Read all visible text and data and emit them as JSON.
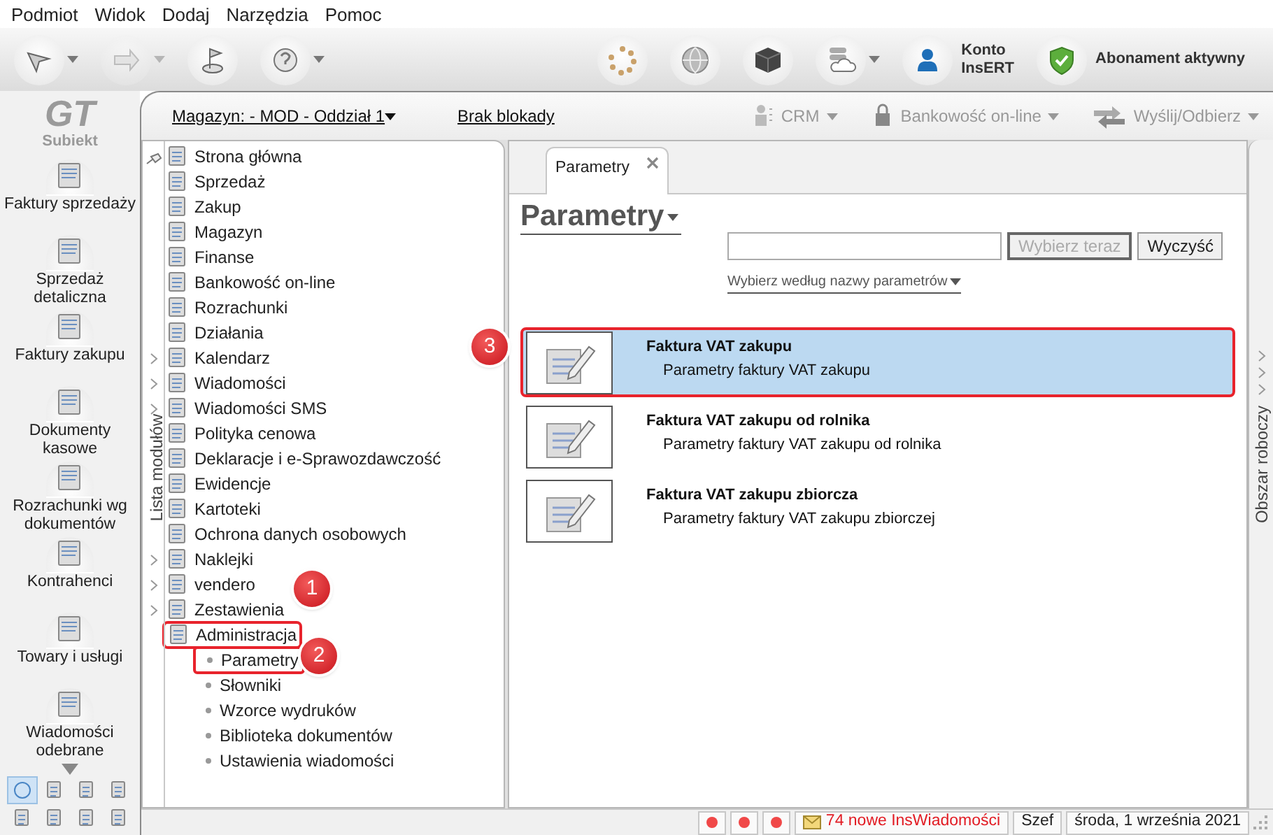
{
  "menu": [
    {
      "label": "Podmiot"
    },
    {
      "label": "Widok"
    },
    {
      "label": "Dodaj"
    },
    {
      "label": "Narzędzia"
    },
    {
      "label": "Pomoc"
    }
  ],
  "toolbar": {
    "left": [
      {
        "kind": "arrow",
        "dropdown": true,
        "disabled": false
      },
      {
        "kind": "forward",
        "dropdown": true,
        "disabled": true
      },
      {
        "kind": "flag",
        "dropdown": false,
        "disabled": false
      },
      {
        "kind": "help",
        "dropdown": true,
        "disabled": false
      }
    ],
    "right": [
      {
        "kind": "spinner",
        "dropdown": false
      },
      {
        "kind": "globe",
        "dropdown": false
      },
      {
        "kind": "cube",
        "dropdown": false
      },
      {
        "kind": "cloud",
        "dropdown": true
      }
    ],
    "account": {
      "line1": "Konto",
      "line2": "InsERT"
    },
    "subscription": "Abonament aktywny"
  },
  "app_logo": {
    "mark": "GT",
    "name": "Subiekt"
  },
  "sidebar": [
    {
      "label": "Faktury sprzedaży"
    },
    {
      "label": "Sprzedaż detaliczna"
    },
    {
      "label": "Faktury zakupu"
    },
    {
      "label": "Dokumenty kasowe"
    },
    {
      "label": "Rozrachunki wg dokumentów"
    },
    {
      "label": "Kontrahenci"
    },
    {
      "label": "Towary i usługi"
    },
    {
      "label": "Wiadomości odebrane"
    }
  ],
  "sidebar_shortcuts": [
    {
      "selected": true
    },
    {
      "selected": false
    },
    {
      "selected": false
    },
    {
      "selected": false
    },
    {
      "selected": false
    },
    {
      "selected": false
    },
    {
      "selected": false
    },
    {
      "selected": false
    }
  ],
  "context_bar": {
    "warehouse": "Magazyn: - MOD - Oddział 1",
    "lock": "Brak blokady",
    "actions": [
      {
        "kind": "crm",
        "label": "CRM",
        "disabled": true
      },
      {
        "kind": "bank",
        "label": "Bankowość on-line",
        "disabled": true
      },
      {
        "kind": "send",
        "label": "Wyślij/Odbierz",
        "disabled": true
      }
    ]
  },
  "modules": {
    "title": "Lista modułów",
    "items": [
      {
        "label": "Strona główna",
        "expandable": false,
        "highlighted": false
      },
      {
        "label": "Sprzedaż",
        "expandable": false,
        "highlighted": false
      },
      {
        "label": "Zakup",
        "expandable": false,
        "highlighted": false
      },
      {
        "label": "Magazyn",
        "expandable": false,
        "highlighted": false
      },
      {
        "label": "Finanse",
        "expandable": false,
        "highlighted": false
      },
      {
        "label": "Bankowość on-line",
        "expandable": false,
        "highlighted": false
      },
      {
        "label": "Rozrachunki",
        "expandable": false,
        "highlighted": false
      },
      {
        "label": "Działania",
        "expandable": false,
        "highlighted": false
      },
      {
        "label": "Kalendarz",
        "expandable": true,
        "highlighted": false
      },
      {
        "label": "Wiadomości",
        "expandable": true,
        "highlighted": false
      },
      {
        "label": "Wiadomości SMS",
        "expandable": true,
        "highlighted": false
      },
      {
        "label": "Polityka cenowa",
        "expandable": false,
        "highlighted": false
      },
      {
        "label": "Deklaracje i e-Sprawozdawczość",
        "expandable": false,
        "highlighted": false
      },
      {
        "label": "Ewidencje",
        "expandable": false,
        "highlighted": false
      },
      {
        "label": "Kartoteki",
        "expandable": false,
        "highlighted": false
      },
      {
        "label": "Ochrona danych osobowych",
        "expandable": false,
        "highlighted": false
      },
      {
        "label": "Naklejki",
        "expandable": true,
        "highlighted": false
      },
      {
        "label": "vendero",
        "expandable": true,
        "highlighted": false
      },
      {
        "label": "Zestawienia",
        "expandable": true,
        "highlighted": false
      },
      {
        "label": "Administracja",
        "expandable": false,
        "highlighted": true,
        "children": [
          {
            "label": "Parametry",
            "highlighted": true
          },
          {
            "label": "Słowniki",
            "highlighted": false
          },
          {
            "label": "Wzorce wydruków",
            "highlighted": false
          },
          {
            "label": "Biblioteka dokumentów",
            "highlighted": false
          },
          {
            "label": "Ustawienia wiadomości",
            "highlighted": false
          }
        ]
      }
    ]
  },
  "tabs": [
    {
      "label": "Parametry",
      "selected": true
    }
  ],
  "page": {
    "title": "Parametry",
    "search_button": {
      "label": "Wybierz teraz",
      "disabled": true
    },
    "clear_button": {
      "label": "Wyczyść",
      "disabled": false
    },
    "filter_link": "Wybierz według nazwy parametrów",
    "results": [
      {
        "title": "Faktura VAT zakupu",
        "subtitle": "Parametry faktury VAT zakupu",
        "selected": true,
        "highlighted": true
      },
      {
        "title": "Faktura VAT zakupu od rolnika",
        "subtitle": "Parametry faktury VAT zakupu od rolnika",
        "selected": false,
        "highlighted": false
      },
      {
        "title": "Faktura VAT zakupu zbiorcza",
        "subtitle": "Parametry faktury VAT zakupu zbiorczej",
        "selected": false,
        "highlighted": false
      }
    ]
  },
  "workspace_title": "Obszar roboczy",
  "status_bar": {
    "messages": "74 nowe InsWiadomości",
    "user": "Szef",
    "date": "środa, 1 września 2021"
  },
  "annotations": [
    {
      "label": "1"
    },
    {
      "label": "2"
    },
    {
      "label": "3"
    }
  ]
}
